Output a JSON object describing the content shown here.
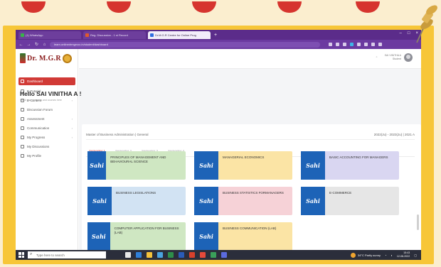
{
  "browser": {
    "tabs": [
      {
        "label": "(1) WhatsApp",
        "active": false
      },
      {
        "label": "Reg. Discussion - 1 st Record",
        "active": false
      },
      {
        "label": "Dr.M.G.R Centre for Online Prog",
        "active": true
      }
    ],
    "new_tab_symbol": "+",
    "url": "learn.onlinedrmgrvoc.in/student/dashboard"
  },
  "sidebar": {
    "logo_text": "Dr. M.G.R",
    "items": [
      {
        "label": "Dashboard",
        "active": true
      },
      {
        "label": "E-Tutorial"
      },
      {
        "label": "E-Content"
      },
      {
        "label": "Discussion Forum"
      },
      {
        "label": "Assessment"
      },
      {
        "label": "Communication"
      },
      {
        "label": "My Progress"
      },
      {
        "label": "My Discussions"
      },
      {
        "label": "My Profile"
      }
    ]
  },
  "header": {
    "user_name": "SAI VINITHA A",
    "user_role": "Student"
  },
  "greeting": {
    "title": "Hello SAI VINITHA A !",
    "subtitle": "Track your progress and courses here"
  },
  "program": {
    "name": "Master of Business Administration | General",
    "batch": "2022(Ju) - 2023(Ju) | 2021 A"
  },
  "semester_tabs": [
    "Semester 1",
    "Semester 2",
    "Semester 3",
    "Semester 4"
  ],
  "badge_text": "Sahi",
  "courses": [
    {
      "title": "PRINCIPLES OF MANAGEMENT AND BEHAVIOURAL SCIENCE",
      "color": "#cfe7c2"
    },
    {
      "title": "MANAGERIAL ECONOMICS",
      "color": "#fbe4a5"
    },
    {
      "title": "BASIC ACCOUNTING FOR MANAGERS",
      "color": "#d9d6f1"
    },
    {
      "title": "BUSINESS LEGISLATIONS",
      "color": "#d2e3f3"
    },
    {
      "title": "BUSINESS STATISTICS FORMANAGERS",
      "color": "#f6d2d7"
    },
    {
      "title": "E-COMMERCE",
      "color": "#e6e6e6"
    },
    {
      "title": "COMPUTER APPLICATION FOR BUSINESS (LAB)",
      "color": "#cfe7c2"
    },
    {
      "title": "BUSINESS COMMUNICATION (LAB)",
      "color": "#fbe4a5"
    }
  ],
  "taskbar": {
    "search_placeholder": "Type here to search",
    "weather": "34°C Partly sunny",
    "time": "15:43",
    "date": "12-08-2022"
  },
  "colors": {
    "accent_red": "#d13a36",
    "badge_blue": "#1d63b7",
    "browser_purple": "#5b2c8a",
    "frame_yellow": "#f7c638"
  }
}
